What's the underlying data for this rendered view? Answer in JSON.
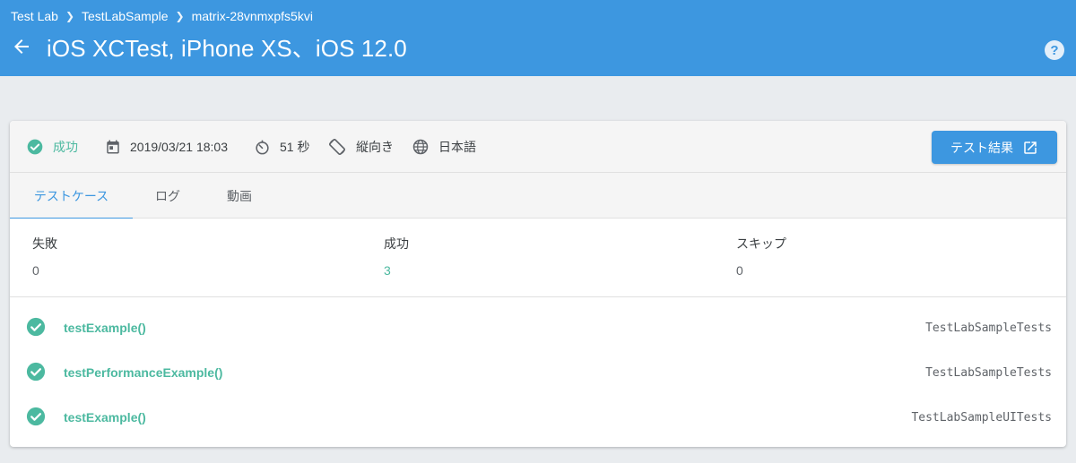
{
  "colors": {
    "header_bg": "#3d97e0",
    "success": "#4cb9a0",
    "accent": "#3d97e0",
    "page_bg": "#e9ecef"
  },
  "breadcrumb": [
    "Test Lab",
    "TestLabSample",
    "matrix-28vnmxpfs5kvi"
  ],
  "breadcrumb_separator_icon": "chevron-right-icon",
  "title": "iOS XCTest, iPhone XS、iOS 12.0",
  "help_icon": "help-circle-icon",
  "help_text": "?",
  "summary": {
    "status": "成功",
    "status_icon": "check-circle-icon",
    "date": "2019/03/21 18:03",
    "date_icon": "calendar-icon",
    "duration": "51 秒",
    "duration_icon": "timer-icon",
    "orientation": "縦向き",
    "orientation_icon": "screen-rotation-icon",
    "locale": "日本語",
    "locale_icon": "globe-icon",
    "results_button": "テスト結果",
    "results_button_icon": "open-in-new-icon"
  },
  "tabs": [
    {
      "label": "テストケース",
      "active": true
    },
    {
      "label": "ログ",
      "active": false
    },
    {
      "label": "動画",
      "active": false
    }
  ],
  "stats": [
    {
      "label": "失敗",
      "value": "0"
    },
    {
      "label": "成功",
      "value": "3"
    },
    {
      "label": "スキップ",
      "value": "0"
    }
  ],
  "cases": [
    {
      "name": "testExample()",
      "suite": "TestLabSampleTests",
      "status": "passed"
    },
    {
      "name": "testPerformanceExample()",
      "suite": "TestLabSampleTests",
      "status": "passed"
    },
    {
      "name": "testExample()",
      "suite": "TestLabSampleUITests",
      "status": "passed"
    }
  ]
}
